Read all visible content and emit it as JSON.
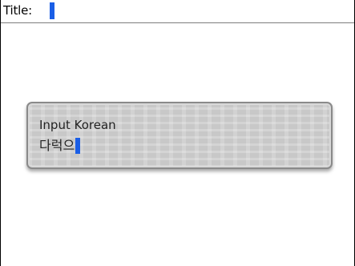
{
  "header": {
    "title_label": "Title:"
  },
  "dialog": {
    "label": "Input Korean",
    "value": "다럭으"
  },
  "colors": {
    "caret": "#1a5ee6",
    "background": "#ffffff",
    "dialog_fill": "#c8c8c8",
    "dialog_border": "#8a8a8a"
  }
}
